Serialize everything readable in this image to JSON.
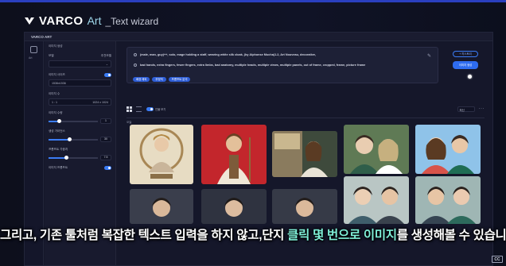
{
  "brand": {
    "name": "VARCO",
    "product": "Art",
    "subtitle": "_Text wizard"
  },
  "app": {
    "title": "VARCO ART",
    "rail": {
      "label": "Art"
    },
    "panel": {
      "header": "이미지 생성",
      "fields": [
        {
          "label": "모델",
          "hint": "추천모델"
        },
        {
          "label": "이미지 사이즈",
          "hint": ""
        },
        {
          "label": "이미지 수",
          "value": "1 : 1",
          "sub": "1024 x 1024"
        },
        {
          "label": "이미지 수량",
          "value": "1"
        },
        {
          "label": "생성 가이던스",
          "value": "30"
        },
        {
          "label": "프롬프트 가중치",
          "value": "7.5"
        },
        {
          "label": "이미지 프롬프트"
        }
      ],
      "input_value": "1536x1536"
    },
    "prompt": {
      "positive": "(male, man, guy)++, solo, mage holding a staff, wearing white silk cloak, (by Alphonse Mucha)1.2, Art Nouveau, decorative,",
      "negative": "bad hands, extra fingers, fewer fingers, extra limbs, bad anatomy, multiple heads, multiple views, multiple panels, out of frame, cropped, frame, picture frame",
      "chips": [
        "배경 제외",
        "부정적",
        "프롬프트 분석"
      ]
    },
    "buttons": {
      "history": "+ 히스토리",
      "generate": "이미지 생성"
    },
    "toolbar": {
      "toggle_label": "인물 보기",
      "sort": "최신"
    },
    "gallery_label": "오늘",
    "thumbs": [
      "mucha-mage-portrait",
      "robed-mage-red-background",
      "rustic-sign-couple",
      "anime-duo-forest",
      "anime-duo-blue-sky",
      "anime-duo-portrait",
      "anime-man-portrait",
      "anime-duo-grey",
      "anime-duo-teal",
      "anime-duo-dark"
    ]
  },
  "subtitle": {
    "part1": "그리고, 기존 툴처럼 복잡한 텍스트 입력을 하지 않고,단지 ",
    "highlight": "클릭 몇 번으로 이미지",
    "part2": "를 생성해볼 수 있습니다."
  },
  "corner_mark": "CC",
  "colors": {
    "accent": "#2e6cf0",
    "subtitle_highlight": "#7ff0d8",
    "background": "#0d0f1c"
  }
}
